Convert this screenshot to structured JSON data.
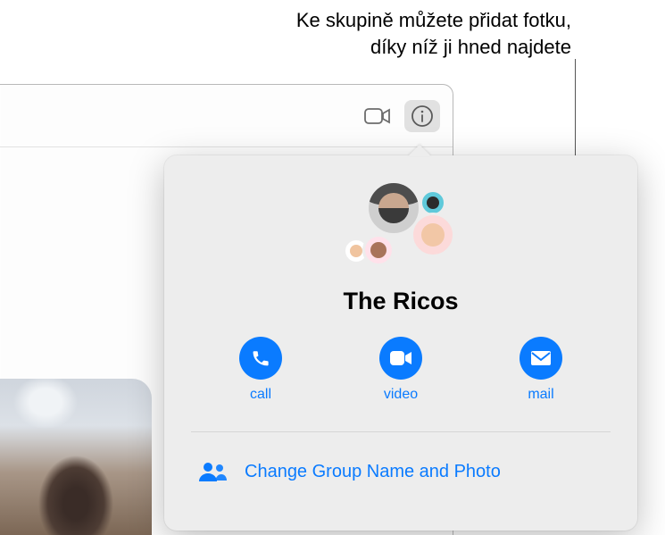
{
  "callout": {
    "line1": "Ke skupině můžete přidat fotku,",
    "line2": "díky níž ji hned najdete"
  },
  "titlebar": {
    "video_icon": "video-icon",
    "info_icon": "info-circle-icon"
  },
  "popover": {
    "group_name": "The Ricos",
    "actions": {
      "call": {
        "label": "call"
      },
      "video": {
        "label": "video"
      },
      "mail": {
        "label": "mail"
      }
    },
    "change_row": {
      "label": "Change Group Name and Photo"
    }
  },
  "colors": {
    "accent": "#0a7bff",
    "popover_bg": "#ededed"
  }
}
